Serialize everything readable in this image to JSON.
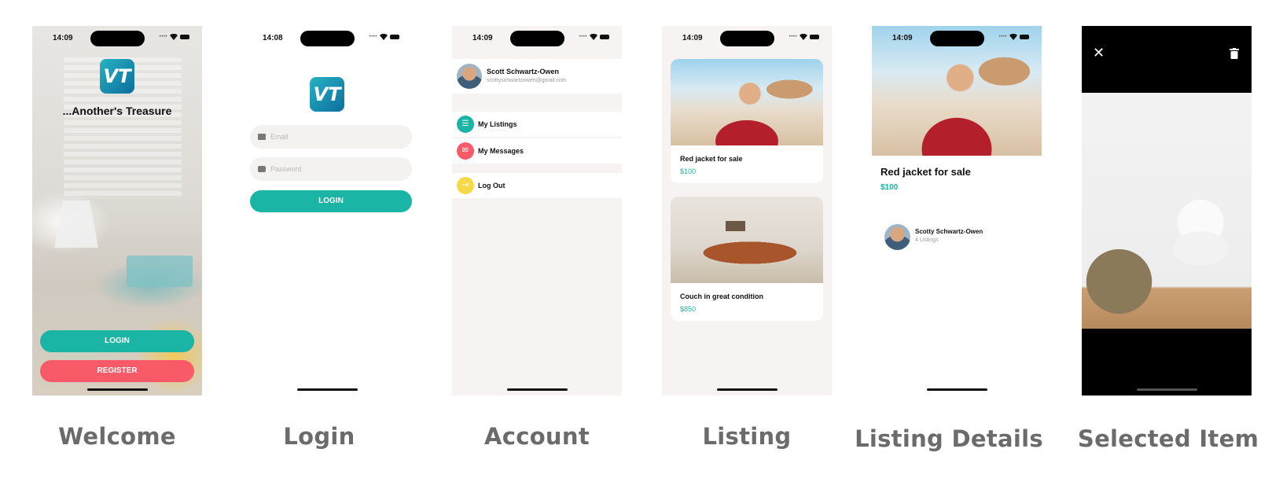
{
  "screens": {
    "welcome": {
      "time": "14:09",
      "logo_text": "VT",
      "title": "...Another's Treasure",
      "login_label": "LOGIN",
      "register_label": "REGISTER",
      "caption": "Welcome"
    },
    "login": {
      "time": "14:08",
      "logo_text": "VT",
      "email_placeholder": "Email",
      "password_placeholder": "Password",
      "login_label": "LOGIN",
      "caption": "Login"
    },
    "account": {
      "time": "14:09",
      "user_name": "Scott Schwartz-Owen",
      "user_email": "scottyschwartzowen@gmail.com",
      "menu": [
        {
          "label": "My Listings",
          "icon": "list-icon",
          "color": "#1bb5a6"
        },
        {
          "label": "My Messages",
          "icon": "mail-icon",
          "color": "#f85a68"
        },
        {
          "label": "Log Out",
          "icon": "logout-icon",
          "color": "#f7d84a"
        }
      ],
      "caption": "Account"
    },
    "listing": {
      "time": "14:09",
      "cards": [
        {
          "title": "Red jacket for sale",
          "price": "$100"
        },
        {
          "title": "Couch in great condition",
          "price": "$850"
        }
      ],
      "caption": "Listing"
    },
    "details": {
      "time": "14:09",
      "title": "Red jacket for sale",
      "price": "$100",
      "seller_name": "Scotty Schwartz-Owen",
      "seller_listings": "4 Listings",
      "caption": "Listing Details"
    },
    "selected": {
      "close_symbol": "✕",
      "caption": "Selected Item"
    }
  },
  "colors": {
    "primary": "#1bb5a6",
    "secondary": "#f85a68",
    "caption_gray": "#6b6b6b"
  }
}
